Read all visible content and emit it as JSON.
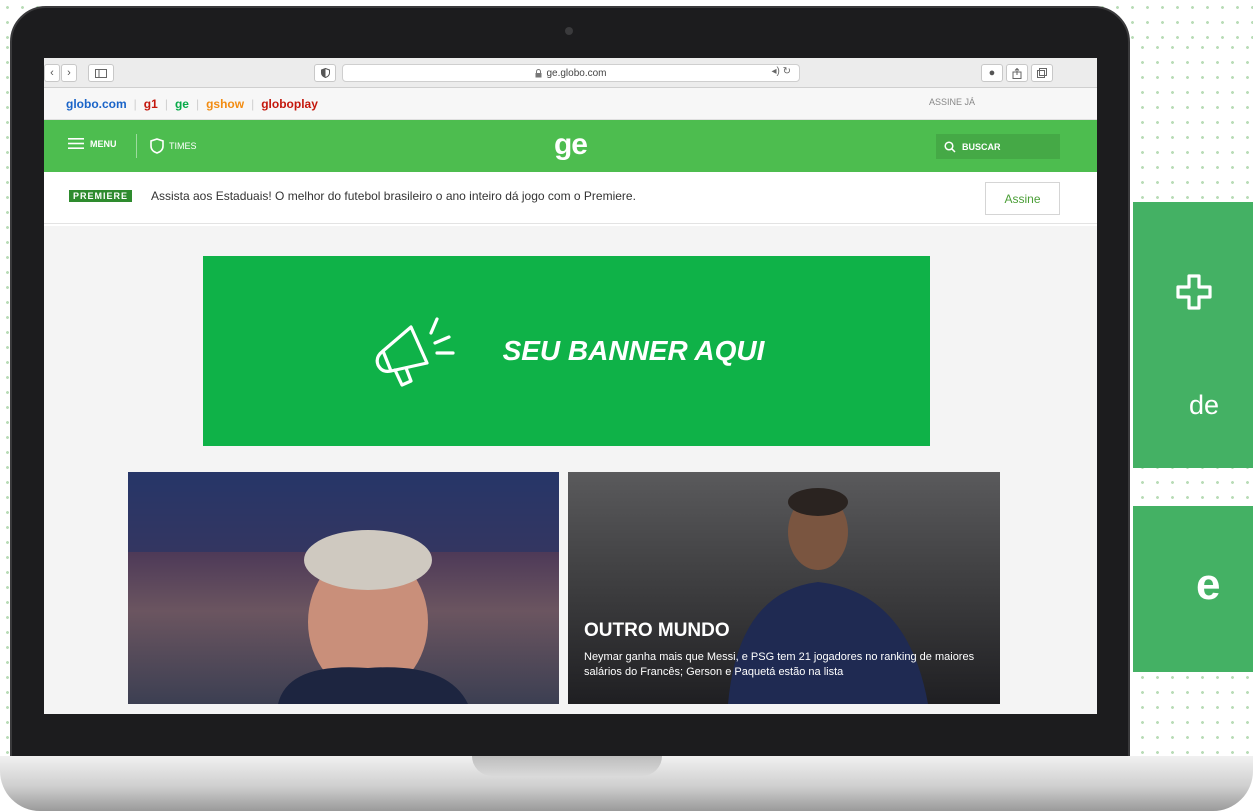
{
  "browser": {
    "url": "ge.globo.com",
    "secure_icon": "lock-icon"
  },
  "globo_nav": {
    "links": [
      {
        "label": "globo.com",
        "color": "#1a64c8"
      },
      {
        "label": "g1",
        "color": "#c4170c"
      },
      {
        "label": "ge",
        "color": "#06aa48"
      },
      {
        "label": "gshow",
        "color": "#f28c12"
      },
      {
        "label": "globoplay",
        "color": "#c4170c"
      }
    ],
    "subscribe_label": "ASSINE JÁ"
  },
  "header": {
    "menu_label": "MENU",
    "times_label": "TIMES",
    "logo": "ge",
    "search_label": "BUSCAR",
    "color": "#4dbd4f"
  },
  "promo": {
    "badge": "PREMIERE",
    "text": "Assista aos Estaduais! O melhor do futebol brasileiro o ano inteiro dá jogo com o Premiere.",
    "button": "Assine"
  },
  "banner": {
    "text": "SEU BANNER AQUI",
    "icon": "megaphone-icon",
    "color": "#0fb248"
  },
  "cards": [
    {
      "title": "",
      "text": ""
    },
    {
      "title": "OUTRO MUNDO",
      "text": "Neymar ganha mais que Messi, e PSG tem 21 jogadores no ranking de maiores salários do Francês; Gerson e Paquetá estão na lista"
    }
  ],
  "side_panels": {
    "panel1_text": "de",
    "panel2_text": "e",
    "icon": "plus-icon",
    "color": "#44b164"
  }
}
